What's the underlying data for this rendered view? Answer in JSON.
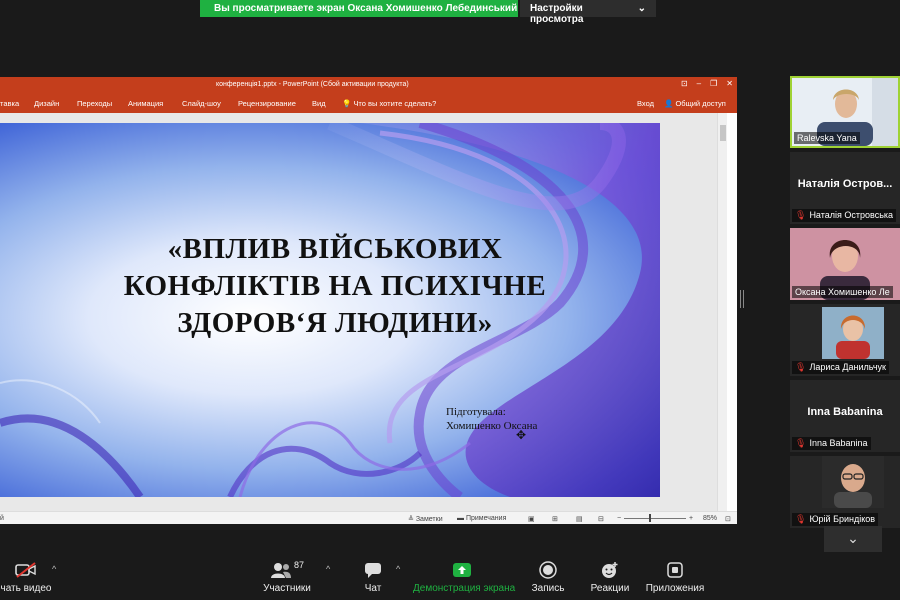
{
  "banner": {
    "sharing_text": "Вы просматриваете экран Оксана Хомишенко Лебединський ...",
    "view_options": "Настройки просмотра",
    "chevron": "⌄"
  },
  "ppt": {
    "window_title": "конференція1.pptx - PowerPoint (Сбой активации продукта)",
    "ribbon": {
      "insert": "тавка",
      "design": "Дизайн",
      "transitions": "Переходы",
      "animation": "Анимация",
      "slideshow": "Слайд-шоу",
      "review": "Рецензирование",
      "view": "Вид",
      "tell_me": "Что вы хотите сделать?",
      "sign_in": "Вход",
      "share": "Общий доступ"
    },
    "slide": {
      "title_line1": "«ВПЛИВ ВІЙСЬКОВИХ",
      "title_line2": "КОНФЛІКТІВ НА ПСИХІЧНЕ",
      "title_line3": "ЗДОРОВ‘Я ЛЮДИНИ»",
      "prepared_by": "Підготувала:",
      "author": "Хомишенко Оксана"
    },
    "status": {
      "left": "й",
      "notes": "Заметки",
      "comments": "Примечания",
      "zoom_minus": "−",
      "zoom_plus": "+",
      "zoom": "85%"
    }
  },
  "participants": [
    {
      "name": "Ralevska Yana",
      "video": true,
      "active": true,
      "muted": false
    },
    {
      "name": "Наталія Островська",
      "display": "Наталія  Остров...",
      "video": false,
      "muted": true
    },
    {
      "name": "Оксана Хомишенко Ле",
      "video": true,
      "muted": false
    },
    {
      "name": "Лариса Данильчук",
      "video": true,
      "muted": true
    },
    {
      "name": "Inna Babanina",
      "display": "Inna Babanina",
      "video": false,
      "muted": true
    },
    {
      "name": "Юрій Бриндіков",
      "video": true,
      "muted": true
    }
  ],
  "toolbar": {
    "start_video": "чать видео",
    "participants": "Участники",
    "participants_count": "87",
    "chat": "Чат",
    "share_screen": "Демонстрация экрана",
    "record": "Запись",
    "reactions": "Реакции",
    "apps": "Приложения"
  },
  "colors": {
    "ppt_accent": "#c43e1c",
    "share_green": "#1fb141",
    "active_speaker": "#9fd234",
    "muted_red": "#e0362f"
  }
}
